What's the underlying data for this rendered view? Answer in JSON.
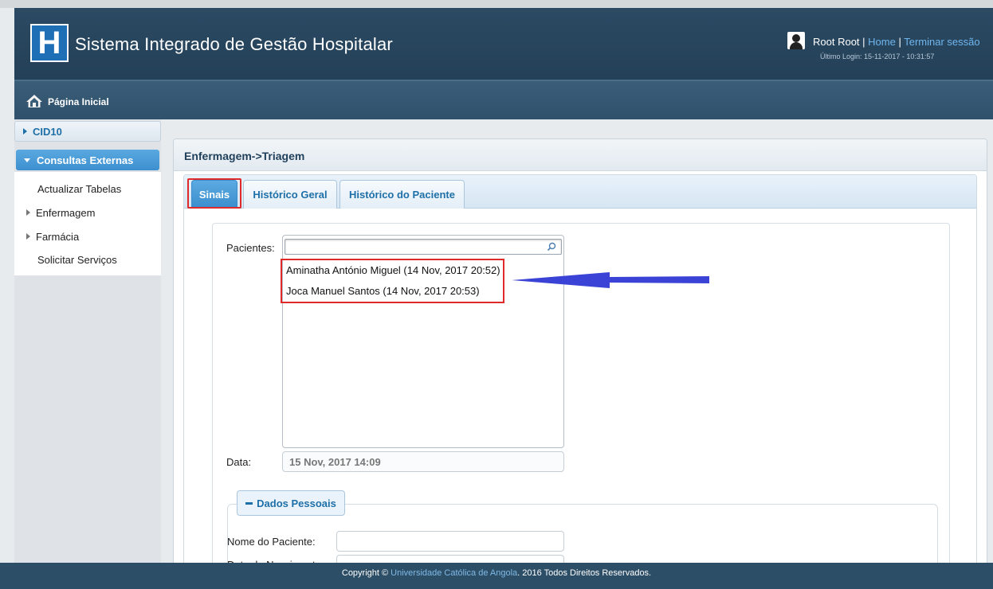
{
  "header": {
    "logo_letter": "H",
    "title": "Sistema Integrado de Gestão Hospitalar",
    "user_name": "Root Root",
    "separator": " | ",
    "home_link": "Home",
    "logout_link": "Terminar sessão",
    "last_login": "Último Login: 15-11-2017 - 10:31:57"
  },
  "nav": {
    "home_label": "Página Inicial",
    "icon": "home-icon"
  },
  "sidebar": {
    "sections": [
      {
        "label": "CID10",
        "expanded": false
      },
      {
        "label": "Consultas Externas",
        "expanded": true
      }
    ],
    "items": [
      {
        "label": "Actualizar Tabelas",
        "has_children": false
      },
      {
        "label": "Enfermagem",
        "has_children": true
      },
      {
        "label": "Farmácia",
        "has_children": true
      },
      {
        "label": "Solicitar Serviços",
        "has_children": false
      }
    ]
  },
  "main": {
    "breadcrumb": "Enfermagem->Triagem",
    "tabs": [
      {
        "label": "Sinais",
        "active": true
      },
      {
        "label": "Histórico Geral",
        "active": false
      },
      {
        "label": "Histórico do Paciente",
        "active": false
      }
    ],
    "form": {
      "patients_label": "Pacientes:",
      "search_value": "",
      "patients": [
        "Aminatha António Miguel (14 Nov, 2017 20:52)",
        "Joca Manuel Santos (14 Nov, 2017 20:53)"
      ],
      "date_label": "Data:",
      "date_value": "15 Nov, 2017 14:09",
      "section_personal": "Dados Pessoais",
      "patient_name_label": "Nome do Paciente:",
      "birth_date_label": "Data de Nascimento:"
    }
  },
  "footer": {
    "prefix": "Copyright © ",
    "university": "Universidade Católica de Angola",
    "suffix": ". 2016 Todos Direitos Reservados."
  },
  "colors": {
    "header_bg": "#2c4a63",
    "accent_blue": "#3c8fcf",
    "highlight_red": "#e02a2a",
    "arrow_blue": "#3a43d6"
  }
}
